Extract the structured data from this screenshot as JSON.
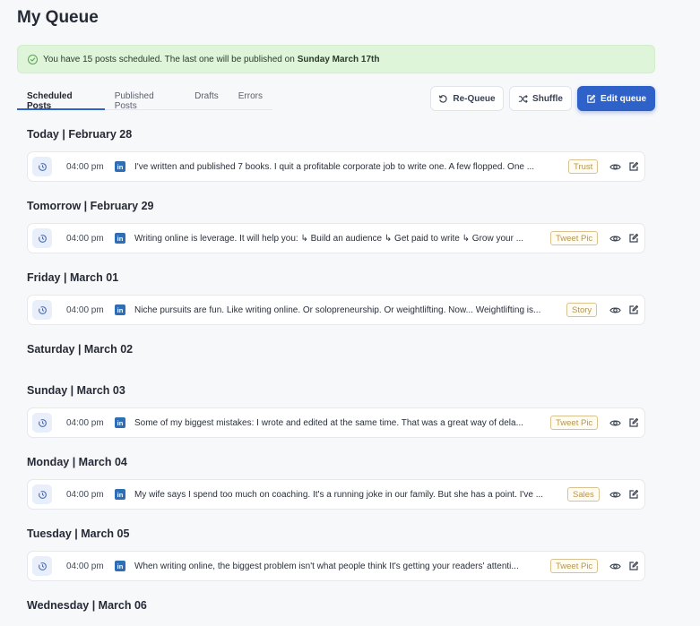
{
  "page": {
    "title": "My Queue"
  },
  "banner": {
    "text": "You have 15 posts scheduled. The last one will be published on",
    "date": "Sunday March 17th",
    "icon": "check-circle-icon",
    "color": "#dff5d9"
  },
  "tabs": [
    {
      "label": "Scheduled Posts",
      "active": true
    },
    {
      "label": "Published Posts",
      "active": false
    },
    {
      "label": "Drafts",
      "active": false
    },
    {
      "label": "Errors",
      "active": false
    }
  ],
  "actions": {
    "requeue_label": "Re-Queue",
    "shuffle_label": "Shuffle",
    "edit_label": "Edit queue"
  },
  "colors": {
    "accent": "#2f62c8",
    "badge": "#b8944a",
    "linkedin": "#2f6eb5"
  },
  "days": [
    {
      "heading": "Today | February 28",
      "post": {
        "time": "04:00 pm",
        "network": "in",
        "text": "I've written and published 7 books. I quit a profitable corporate job to write one. A few flopped. One ...",
        "tag": "Trust"
      }
    },
    {
      "heading": "Tomorrow | February 29",
      "post": {
        "time": "04:00 pm",
        "network": "in",
        "text": "Writing online is leverage. It will help you: ↳ Build an audience ↳ Get paid to write ↳ Grow your ...",
        "tag": "Tweet Pic"
      }
    },
    {
      "heading": "Friday | March 01",
      "post": {
        "time": "04:00 pm",
        "network": "in",
        "text": "Niche pursuits are fun. Like writing online. Or solopreneurship. Or weightlifting. Now... Weightlifting is...",
        "tag": "Story"
      }
    },
    {
      "heading": "Saturday | March 02",
      "post": null
    },
    {
      "heading": "Sunday | March 03",
      "post": {
        "time": "04:00 pm",
        "network": "in",
        "text": "Some of my biggest mistakes: I wrote and edited at the same time. That was a great way of dela...",
        "tag": "Tweet Pic"
      }
    },
    {
      "heading": "Monday | March 04",
      "post": {
        "time": "04:00 pm",
        "network": "in",
        "text": "My wife says I spend too much on coaching. It's a running joke in our family. But she has a point. I've ...",
        "tag": "Sales"
      }
    },
    {
      "heading": "Tuesday | March 05",
      "post": {
        "time": "04:00 pm",
        "network": "in",
        "text": "When writing online, the biggest problem isn't what people think It's getting your readers' attenti...",
        "tag": "Tweet Pic"
      }
    },
    {
      "heading": "Wednesday | March 06",
      "post": null
    }
  ]
}
